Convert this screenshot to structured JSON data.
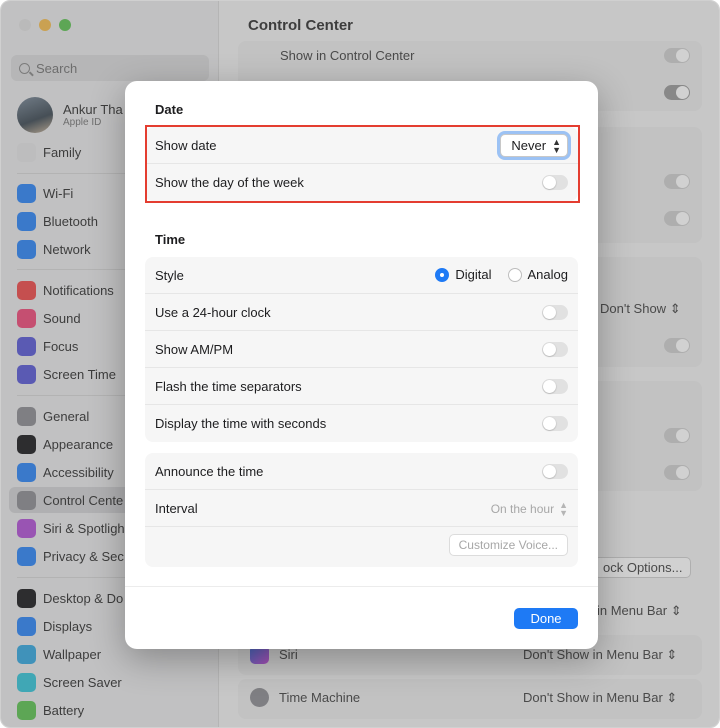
{
  "window": {
    "title": "Control Center"
  },
  "sidebar": {
    "search_placeholder": "Search",
    "account": {
      "name": "Ankur Tha",
      "subtitle": "Apple ID"
    },
    "family_label": "Family",
    "items": [
      {
        "label": "Wi-Fi",
        "icon": "wifi-icon",
        "color": "#2f86f6"
      },
      {
        "label": "Bluetooth",
        "icon": "bluetooth-icon",
        "color": "#2f86f6"
      },
      {
        "label": "Network",
        "icon": "network-icon",
        "color": "#2f86f6"
      },
      {
        "label": "Notifications",
        "icon": "notifications-icon",
        "color": "#ef4b4b"
      },
      {
        "label": "Sound",
        "icon": "sound-icon",
        "color": "#ef4b7a"
      },
      {
        "label": "Focus",
        "icon": "focus-icon",
        "color": "#5b5bd6"
      },
      {
        "label": "Screen Time",
        "icon": "screen-time-icon",
        "color": "#5b5bd6"
      },
      {
        "label": "General",
        "icon": "general-icon",
        "color": "#8e8e93"
      },
      {
        "label": "Appearance",
        "icon": "appearance-icon",
        "color": "#1d1d1f"
      },
      {
        "label": "Accessibility",
        "icon": "accessibility-icon",
        "color": "#2f86f6"
      },
      {
        "label": "Control Cente",
        "icon": "control-center-icon",
        "color": "#8e8e93"
      },
      {
        "label": "Siri & Spotligh",
        "icon": "siri-icon",
        "color": "#b253d6"
      },
      {
        "label": "Privacy & Sec",
        "icon": "privacy-icon",
        "color": "#2f86f6"
      },
      {
        "label": "Desktop & Do",
        "icon": "desktop-icon",
        "color": "#1d1d1f"
      },
      {
        "label": "Displays",
        "icon": "displays-icon",
        "color": "#2f86f6"
      },
      {
        "label": "Wallpaper",
        "icon": "wallpaper-icon",
        "color": "#36a8e0"
      },
      {
        "label": "Screen Saver",
        "icon": "screen-saver-icon",
        "color": "#36c5d8"
      },
      {
        "label": "Battery",
        "icon": "battery-icon",
        "color": "#5fc454"
      }
    ]
  },
  "background": {
    "show_in_control_center": "Show in Control Center",
    "dont_show": "Don't Show",
    "clock_options": "ock Options...",
    "in_menu_bar": "in Menu Bar",
    "siri_label": "Siri",
    "siri_value": "Don't Show in Menu Bar",
    "time_machine_label": "Time Machine",
    "time_machine_value": "Don't Show in Menu Bar"
  },
  "modal": {
    "date_section": {
      "title": "Date",
      "show_date_label": "Show date",
      "show_date_value": "Never",
      "day_of_week_label": "Show the day of the week"
    },
    "time_section": {
      "title": "Time",
      "style_label": "Style",
      "style_options": [
        "Digital",
        "Analog"
      ],
      "style_selected": "Digital",
      "rows": [
        "Use a 24-hour clock",
        "Show AM/PM",
        "Flash the time separators",
        "Display the time with seconds"
      ]
    },
    "announce": {
      "label": "Announce the time",
      "interval_label": "Interval",
      "interval_value": "On the hour",
      "customize_label": "Customize Voice..."
    },
    "done_label": "Done"
  },
  "colors": {
    "accent": "#1e7af5",
    "highlight_box": "#e43d30"
  }
}
